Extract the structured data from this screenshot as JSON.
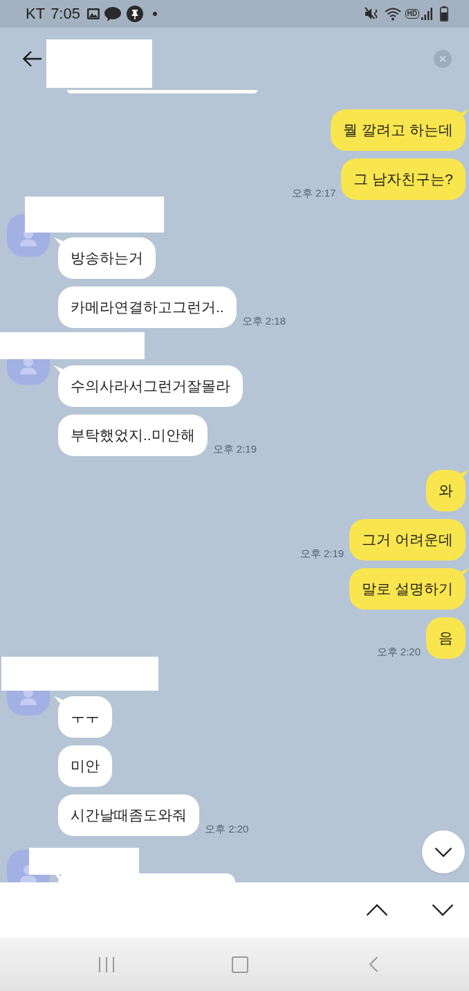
{
  "status_bar": {
    "carrier": "KT",
    "time": "7:05",
    "hd_label": "HD"
  },
  "header": {
    "title_redacted": true
  },
  "chat": {
    "bubble_cut_above": true,
    "runs": [
      {
        "kind": "outgoing",
        "bubbles": [
          "뭘 깔려고 하는데",
          "그 남자친구는?"
        ],
        "time": "오후 2:17",
        "cut_off": false
      },
      {
        "kind": "incoming",
        "name_redacted": true,
        "bubbles": [
          "방송하는거",
          "카메라연결하고그런거.."
        ],
        "time": "오후 2:18",
        "cut_off": false
      },
      {
        "kind": "incoming",
        "name_redacted": true,
        "bubbles": [
          "수의사라서그런거잘몰라",
          "부탁했었지..미안해"
        ],
        "time": "오후 2:19",
        "cut_off": false
      },
      {
        "kind": "outgoing",
        "bubbles": [
          "와",
          "그거 어려운데"
        ],
        "time": "오후 2:19",
        "cut_off": false
      },
      {
        "kind": "outgoing",
        "bubbles": [
          "말로 설명하기",
          "음"
        ],
        "time": "오후 2:20",
        "cut_off": false
      },
      {
        "kind": "incoming",
        "name_redacted": true,
        "bubbles": [
          "ㅜㅜ",
          "미안",
          "시간날때좀도와줘"
        ],
        "time": "오후 2:20",
        "cut_off": false
      },
      {
        "kind": "incoming",
        "name_redacted": true,
        "cut_off": true
      }
    ]
  }
}
